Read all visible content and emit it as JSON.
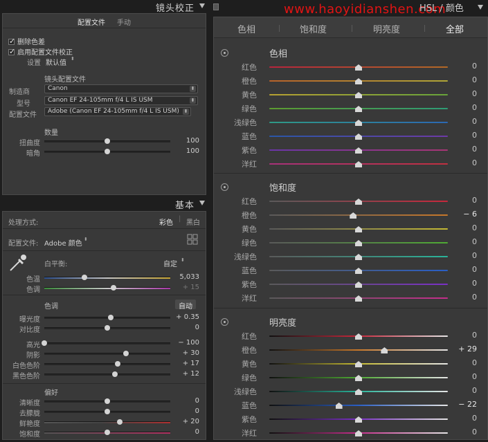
{
  "lens": {
    "header_title": "镜头校正",
    "tabs": [
      "配置文件",
      "手动"
    ],
    "checks": [
      "删除色差",
      "启用配置文件校正"
    ],
    "setting_label": "设置",
    "setting_value": "默认值",
    "profile_heading": "镜头配置文件",
    "maker_label": "制造商",
    "maker_value": "Canon",
    "model_label": "型号",
    "model_value": "Canon EF 24-105mm f/4 L IS USM",
    "profile_label": "配置文件",
    "profile_value": "Adobe (Canon EF 24-105mm f/4 L IS USM)",
    "amount_heading": "数量",
    "sliders": [
      {
        "label": "扭曲度",
        "value": "100",
        "pos": 0.5
      },
      {
        "label": "暗角",
        "value": "100",
        "pos": 0.5
      }
    ]
  },
  "basic": {
    "header_title": "基本",
    "treatment_label": "处理方式:",
    "treatment_color": "彩色",
    "treatment_bw": "黑白",
    "profile_label": "配置文件:",
    "profile_value": "Adobe 颜色",
    "wb_label": "白平衡:",
    "wb_value": "自定",
    "wb_sliders": [
      {
        "label": "色温",
        "value": "5,033",
        "pos": 0.32
      },
      {
        "label": "色调",
        "value": "+ 15",
        "pos": 0.55
      }
    ],
    "tone_heading": "色调",
    "auto_label": "自动",
    "tone_sliders": [
      {
        "label": "曝光度",
        "value": "+ 0.35",
        "pos": 0.53
      },
      {
        "label": "对比度",
        "value": "0",
        "pos": 0.5
      }
    ],
    "tone2_sliders": [
      {
        "label": "高光",
        "value": "− 100",
        "pos": 0.0
      },
      {
        "label": "阴影",
        "value": "+ 30",
        "pos": 0.65
      },
      {
        "label": "白色色阶",
        "value": "+ 17",
        "pos": 0.58
      },
      {
        "label": "黑色色阶",
        "value": "+ 12",
        "pos": 0.56
      }
    ],
    "presence_heading": "偏好",
    "presence_sliders": [
      {
        "label": "清晰度",
        "value": "0",
        "pos": 0.5
      },
      {
        "label": "去朦胧",
        "value": "0",
        "pos": 0.5
      },
      {
        "label": "鲜艳度",
        "value": "+ 20",
        "pos": 0.6
      },
      {
        "label": "饱和度",
        "value": "0",
        "pos": 0.5
      }
    ]
  },
  "hsl": {
    "title": "HSL / 颜色",
    "watermark": "www.haoyidianshen.com",
    "tabs": [
      "色相",
      "饱和度",
      "明亮度",
      "全部"
    ],
    "active_tab": 3,
    "sections": [
      {
        "title": "色相",
        "rows": [
          {
            "label": "红色",
            "value": "0",
            "pos": 0.5
          },
          {
            "label": "橙色",
            "value": "0",
            "pos": 0.5
          },
          {
            "label": "黄色",
            "value": "0",
            "pos": 0.5
          },
          {
            "label": "绿色",
            "value": "0",
            "pos": 0.5
          },
          {
            "label": "浅绿色",
            "value": "0",
            "pos": 0.5
          },
          {
            "label": "蓝色",
            "value": "0",
            "pos": 0.5
          },
          {
            "label": "紫色",
            "value": "0",
            "pos": 0.5
          },
          {
            "label": "洋红",
            "value": "0",
            "pos": 0.5
          }
        ]
      },
      {
        "title": "饱和度",
        "rows": [
          {
            "label": "红色",
            "value": "0",
            "pos": 0.5
          },
          {
            "label": "橙色",
            "value": "− 6",
            "pos": 0.47
          },
          {
            "label": "黄色",
            "value": "0",
            "pos": 0.5
          },
          {
            "label": "绿色",
            "value": "0",
            "pos": 0.5
          },
          {
            "label": "浅绿色",
            "value": "0",
            "pos": 0.5
          },
          {
            "label": "蓝色",
            "value": "0",
            "pos": 0.5
          },
          {
            "label": "紫色",
            "value": "0",
            "pos": 0.5
          },
          {
            "label": "洋红",
            "value": "0",
            "pos": 0.5
          }
        ]
      },
      {
        "title": "明亮度",
        "rows": [
          {
            "label": "红色",
            "value": "0",
            "pos": 0.5
          },
          {
            "label": "橙色",
            "value": "+ 29",
            "pos": 0.645
          },
          {
            "label": "黄色",
            "value": "0",
            "pos": 0.5
          },
          {
            "label": "绿色",
            "value": "0",
            "pos": 0.5
          },
          {
            "label": "浅绿色",
            "value": "0",
            "pos": 0.5
          },
          {
            "label": "蓝色",
            "value": "− 22",
            "pos": 0.39
          },
          {
            "label": "紫色",
            "value": "0",
            "pos": 0.5
          },
          {
            "label": "洋红",
            "value": "0",
            "pos": 0.5
          }
        ]
      }
    ]
  },
  "colors": {
    "hue": [
      "#b8243c",
      "#b8622a",
      "#b7a132",
      "#5d9c2f",
      "#2f9a86",
      "#2a57a8",
      "#6a36a8",
      "#a8327a"
    ],
    "hue_end": [
      "#b46a26",
      "#b0a637",
      "#68a43a",
      "#2e9c76",
      "#2c68b3",
      "#6e3aa8",
      "#a83575",
      "#c13040"
    ],
    "sat_start": "#5a5a5a",
    "sat": [
      "#c8283c",
      "#c8782a",
      "#c6bb34",
      "#4fab34",
      "#2ab49a",
      "#2a5fc6",
      "#7a30c6",
      "#c62e8c"
    ],
    "lum_start": "#101010",
    "lum_end": "#e6e6e6"
  }
}
